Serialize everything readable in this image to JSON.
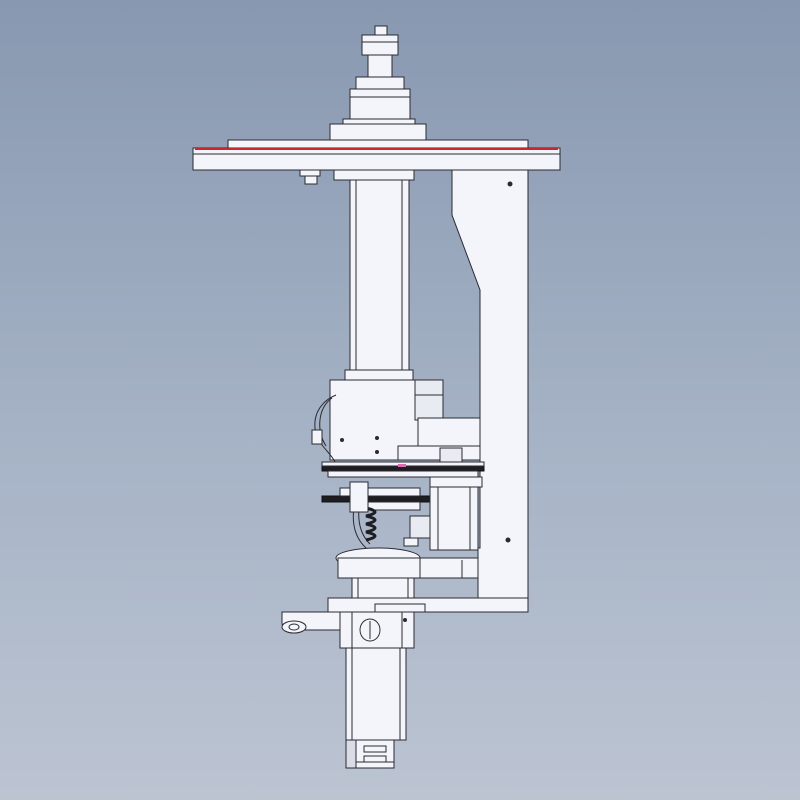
{
  "view": {
    "background_top": "#8898b0",
    "background_bottom": "#bcc4d2",
    "part_fill": "#f4f5fa",
    "edge_color": "#2a2a33",
    "accent_red": "#c8282d"
  }
}
